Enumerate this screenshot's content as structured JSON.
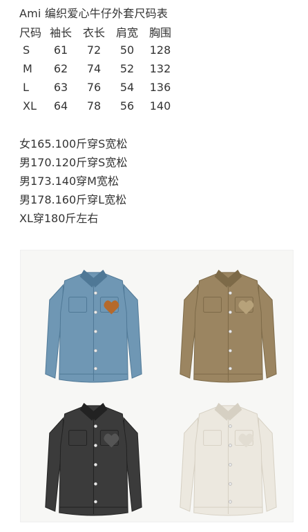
{
  "title": "Ami 编织爱心牛仔外套尺码表",
  "size_table": {
    "headers": [
      "尺码",
      "袖长",
      "衣长",
      "肩宽",
      "胸围"
    ],
    "rows": [
      [
        "S",
        "61",
        "72",
        "50",
        "128"
      ],
      [
        "M",
        "62",
        "74",
        "52",
        "132"
      ],
      [
        "L",
        "63",
        "76",
        "54",
        "136"
      ],
      [
        "XL",
        "64",
        "78",
        "56",
        "140"
      ]
    ]
  },
  "notes": [
    "女165.100斤穿S宽松",
    "男170.120斤穿S宽松",
    "男173.140穿M宽松",
    "男178.160斤穿L宽松",
    "XL穿180斤左右"
  ],
  "colors": {
    "text": "#333333",
    "denim_blue": "#6f97b4",
    "khaki": "#9b8561",
    "black": "#3b3b3b",
    "cream": "#ece8df"
  },
  "product_image": {
    "items": [
      {
        "name": "blue-denim-jacket",
        "color": "#6f97b4",
        "shade": "#4f7896",
        "patch": "#b56a2c"
      },
      {
        "name": "khaki-jacket",
        "color": "#9b8561",
        "shade": "#7d6a48",
        "patch": "#b7a27a"
      },
      {
        "name": "black-jacket",
        "color": "#3b3b3b",
        "shade": "#222222",
        "patch": "#555555"
      },
      {
        "name": "cream-jacket",
        "color": "#ece8df",
        "shade": "#d6d0c3",
        "patch": "#e2ddd2"
      }
    ]
  }
}
